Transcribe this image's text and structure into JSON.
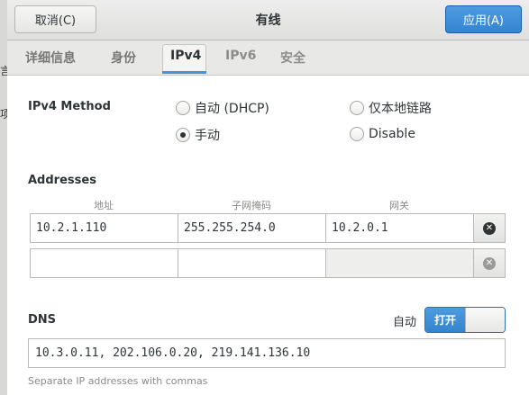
{
  "background_fragments": [
    "言",
    "项"
  ],
  "header": {
    "cancel_label": "取消(C)",
    "title": "有线",
    "apply_label": "应用(A)"
  },
  "tabs": [
    {
      "label": "详细信息",
      "state": "normal"
    },
    {
      "label": "身份",
      "state": "normal"
    },
    {
      "label": "IPv4",
      "state": "active"
    },
    {
      "label": "IPv6",
      "state": "dim"
    },
    {
      "label": "安全",
      "state": "dim"
    }
  ],
  "ipv4_method": {
    "label": "IPv4 Method",
    "options": [
      {
        "label": "自动 (DHCP)",
        "checked": false
      },
      {
        "label": "仅本地链路",
        "checked": false
      },
      {
        "label": "手动",
        "checked": true
      },
      {
        "label": "Disable",
        "checked": false
      }
    ]
  },
  "addresses": {
    "label": "Addresses",
    "columns": [
      "地址",
      "子网掩码",
      "网关"
    ],
    "rows": [
      {
        "address": "10.2.1.110",
        "netmask": "255.255.254.0",
        "gateway": "10.2.0.1"
      },
      {
        "address": "",
        "netmask": "",
        "gateway": ""
      }
    ]
  },
  "dns": {
    "label": "DNS",
    "auto_label": "自动",
    "toggle_label": "打开",
    "toggle_on": true,
    "value": "10.3.0.11, 202.106.0.20, 219.141.136.10",
    "hint": "Separate IP addresses with commas"
  },
  "colors": {
    "accent": "#3584d1",
    "text": "#2e3436"
  }
}
